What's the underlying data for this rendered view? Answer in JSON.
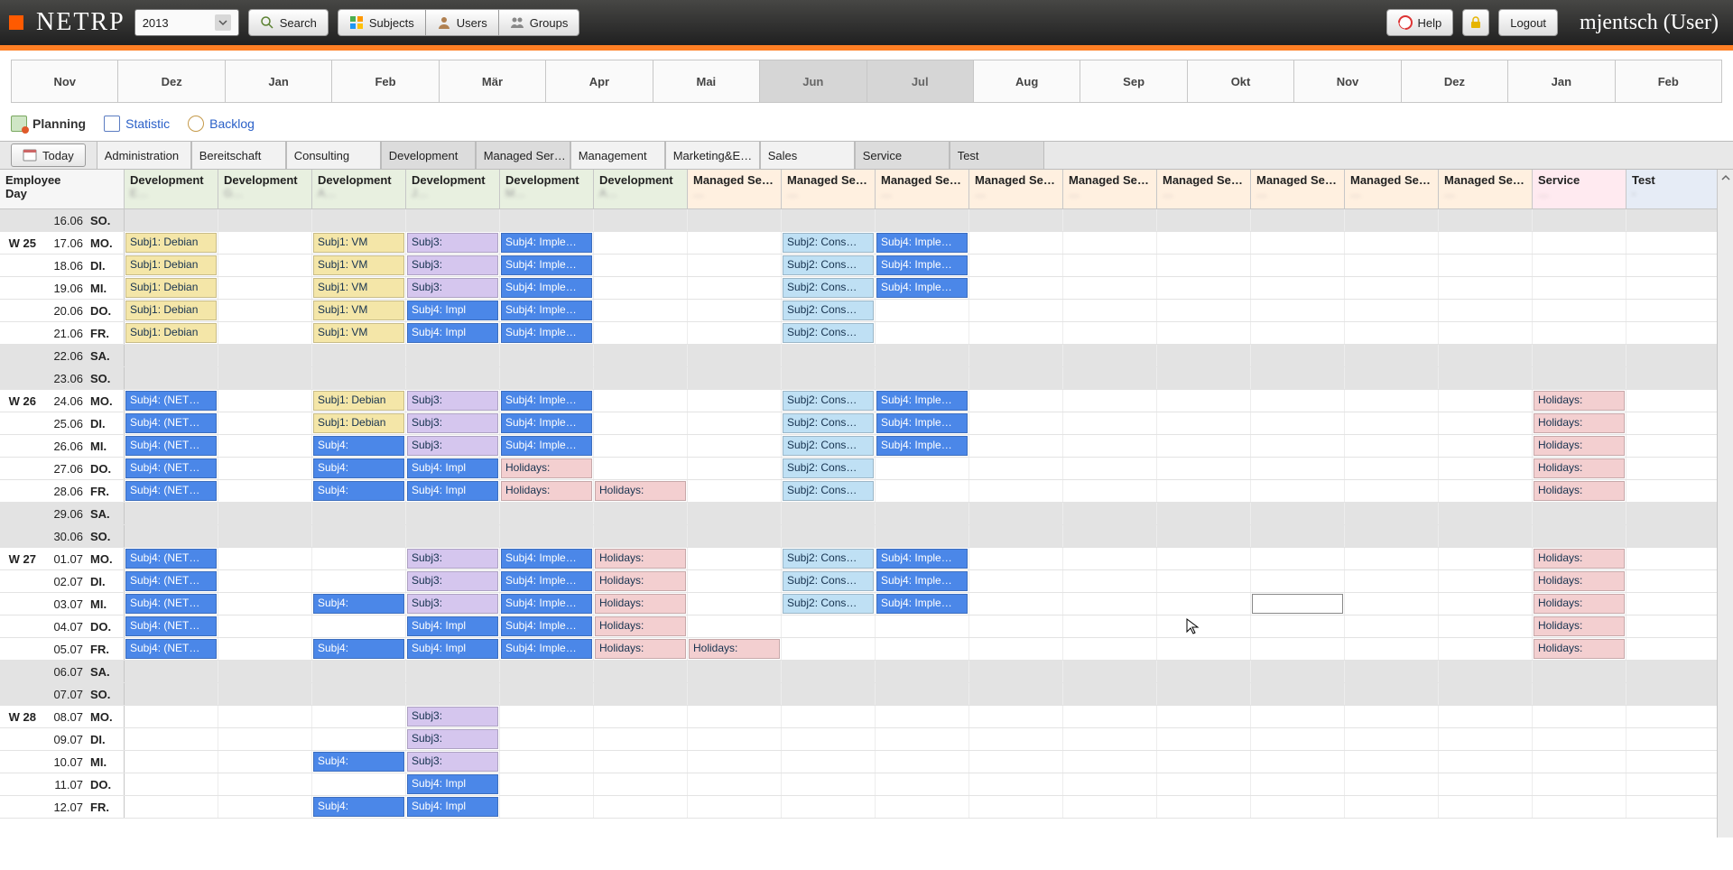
{
  "app": {
    "name": "NETRP",
    "year": "2013"
  },
  "toolbar": {
    "search": "Search",
    "subjects": "Subjects",
    "users": "Users",
    "groups": "Groups",
    "help": "Help",
    "logout": "Logout",
    "user": "mjentsch (User)"
  },
  "months": [
    {
      "label": "Nov",
      "sel": false
    },
    {
      "label": "Dez",
      "sel": false
    },
    {
      "label": "Jan",
      "sel": false
    },
    {
      "label": "Feb",
      "sel": false
    },
    {
      "label": "Mär",
      "sel": false
    },
    {
      "label": "Apr",
      "sel": false
    },
    {
      "label": "Mai",
      "sel": false
    },
    {
      "label": "Jun",
      "sel": true
    },
    {
      "label": "Jul",
      "sel": true
    },
    {
      "label": "Aug",
      "sel": false
    },
    {
      "label": "Sep",
      "sel": false
    },
    {
      "label": "Okt",
      "sel": false
    },
    {
      "label": "Nov",
      "sel": false
    },
    {
      "label": "Dez",
      "sel": false
    },
    {
      "label": "Jan",
      "sel": false
    },
    {
      "label": "Feb",
      "sel": false
    }
  ],
  "viewtabs": [
    {
      "label": "Planning",
      "active": true,
      "icon": "plan"
    },
    {
      "label": "Statistic",
      "active": false,
      "icon": "stat"
    },
    {
      "label": "Backlog",
      "active": false,
      "icon": "back"
    }
  ],
  "today_label": "Today",
  "departments": [
    {
      "label": "Administration",
      "sel": false
    },
    {
      "label": "Bereitschaft",
      "sel": false
    },
    {
      "label": "Consulting",
      "sel": false
    },
    {
      "label": "Development",
      "sel": true
    },
    {
      "label": "Managed Ser…",
      "sel": true
    },
    {
      "label": "Management",
      "sel": false
    },
    {
      "label": "Marketing&E…",
      "sel": false
    },
    {
      "label": "Sales",
      "sel": false
    },
    {
      "label": "Service",
      "sel": true
    },
    {
      "label": "Test",
      "sel": true
    }
  ],
  "grid_header_left": {
    "line1": "Employee",
    "line2": "Day"
  },
  "columns": [
    {
      "title": "Development",
      "type": "Development",
      "sub": "E…"
    },
    {
      "title": "Development",
      "type": "Development",
      "sub": "G…"
    },
    {
      "title": "Development",
      "type": "Development",
      "sub": "A…"
    },
    {
      "title": "Development",
      "type": "Development",
      "sub": "J…"
    },
    {
      "title": "Development",
      "type": "Development",
      "sub": "M…"
    },
    {
      "title": "Development",
      "type": "Development",
      "sub": "A…"
    },
    {
      "title": "Managed Se…",
      "type": "Managed",
      "sub": "…"
    },
    {
      "title": "Managed Se…",
      "type": "Managed",
      "sub": "…"
    },
    {
      "title": "Managed Se…",
      "type": "Managed",
      "sub": "…"
    },
    {
      "title": "Managed Se…",
      "type": "Managed",
      "sub": "…"
    },
    {
      "title": "Managed Se…",
      "type": "Managed",
      "sub": "…"
    },
    {
      "title": "Managed Se…",
      "type": "Managed",
      "sub": "…"
    },
    {
      "title": "Managed Se…",
      "type": "Managed",
      "sub": "…"
    },
    {
      "title": "Managed Se…",
      "type": "Managed",
      "sub": "…"
    },
    {
      "title": "Managed Se…",
      "type": "Managed",
      "sub": "…"
    },
    {
      "title": "Service",
      "type": "Service",
      "sub": "…"
    },
    {
      "title": "Test",
      "type": "Test",
      "sub": "-"
    }
  ],
  "rows": [
    {
      "week": "",
      "date": "16.06",
      "dow": "SO.",
      "weekend": true,
      "cells": []
    },
    {
      "week": "W 25",
      "date": "17.06",
      "dow": "MO.",
      "cells": [
        {
          "c": 0,
          "t": "Subj1: Debian",
          "k": "beige"
        },
        {
          "c": 2,
          "t": "Subj1: VM",
          "k": "beige"
        },
        {
          "c": 3,
          "t": "Subj3:",
          "k": "violet"
        },
        {
          "c": 4,
          "t": "Subj4: Imple…",
          "k": "blue"
        },
        {
          "c": 7,
          "t": "Subj2: Cons…",
          "k": "skyblue"
        },
        {
          "c": 8,
          "t": "Subj4: Imple…",
          "k": "blue"
        }
      ]
    },
    {
      "week": "",
      "date": "18.06",
      "dow": "DI.",
      "cells": [
        {
          "c": 0,
          "t": "Subj1: Debian",
          "k": "beige"
        },
        {
          "c": 2,
          "t": "Subj1: VM",
          "k": "beige"
        },
        {
          "c": 3,
          "t": "Subj3:",
          "k": "violet"
        },
        {
          "c": 4,
          "t": "Subj4: Imple…",
          "k": "blue"
        },
        {
          "c": 7,
          "t": "Subj2: Cons…",
          "k": "skyblue"
        },
        {
          "c": 8,
          "t": "Subj4: Imple…",
          "k": "blue"
        }
      ]
    },
    {
      "week": "",
      "date": "19.06",
      "dow": "MI.",
      "cells": [
        {
          "c": 0,
          "t": "Subj1: Debian",
          "k": "beige"
        },
        {
          "c": 2,
          "t": "Subj1: VM",
          "k": "beige"
        },
        {
          "c": 3,
          "t": "Subj3:",
          "k": "violet"
        },
        {
          "c": 4,
          "t": "Subj4: Imple…",
          "k": "blue"
        },
        {
          "c": 7,
          "t": "Subj2: Cons…",
          "k": "skyblue"
        },
        {
          "c": 8,
          "t": "Subj4: Imple…",
          "k": "blue"
        }
      ]
    },
    {
      "week": "",
      "date": "20.06",
      "dow": "DO.",
      "cells": [
        {
          "c": 0,
          "t": "Subj1: Debian",
          "k": "beige"
        },
        {
          "c": 2,
          "t": "Subj1: VM",
          "k": "beige"
        },
        {
          "c": 3,
          "t": "Subj4: Impl",
          "k": "blue"
        },
        {
          "c": 4,
          "t": "Subj4: Imple…",
          "k": "blue"
        },
        {
          "c": 7,
          "t": "Subj2: Cons…",
          "k": "skyblue"
        }
      ]
    },
    {
      "week": "",
      "date": "21.06",
      "dow": "FR.",
      "cells": [
        {
          "c": 0,
          "t": "Subj1: Debian",
          "k": "beige"
        },
        {
          "c": 2,
          "t": "Subj1: VM",
          "k": "beige"
        },
        {
          "c": 3,
          "t": "Subj4: Impl",
          "k": "blue"
        },
        {
          "c": 4,
          "t": "Subj4: Imple…",
          "k": "blue"
        },
        {
          "c": 7,
          "t": "Subj2: Cons…",
          "k": "skyblue"
        }
      ]
    },
    {
      "week": "",
      "date": "22.06",
      "dow": "SA.",
      "weekend": true,
      "cells": []
    },
    {
      "week": "",
      "date": "23.06",
      "dow": "SO.",
      "weekend": true,
      "cells": []
    },
    {
      "week": "W 26",
      "date": "24.06",
      "dow": "MO.",
      "cells": [
        {
          "c": 0,
          "t": "Subj4: (NET…",
          "k": "blue"
        },
        {
          "c": 2,
          "t": "Subj1: Debian",
          "k": "beige"
        },
        {
          "c": 3,
          "t": "Subj3:",
          "k": "violet"
        },
        {
          "c": 4,
          "t": "Subj4: Imple…",
          "k": "blue"
        },
        {
          "c": 7,
          "t": "Subj2: Cons…",
          "k": "skyblue"
        },
        {
          "c": 8,
          "t": "Subj4: Imple…",
          "k": "blue"
        },
        {
          "c": 15,
          "t": "Holidays:",
          "k": "pink"
        }
      ]
    },
    {
      "week": "",
      "date": "25.06",
      "dow": "DI.",
      "cells": [
        {
          "c": 0,
          "t": "Subj4: (NET…",
          "k": "blue"
        },
        {
          "c": 2,
          "t": "Subj1: Debian",
          "k": "beige"
        },
        {
          "c": 3,
          "t": "Subj3:",
          "k": "violet"
        },
        {
          "c": 4,
          "t": "Subj4: Imple…",
          "k": "blue"
        },
        {
          "c": 7,
          "t": "Subj2: Cons…",
          "k": "skyblue"
        },
        {
          "c": 8,
          "t": "Subj4: Imple…",
          "k": "blue"
        },
        {
          "c": 15,
          "t": "Holidays:",
          "k": "pink"
        }
      ]
    },
    {
      "week": "",
      "date": "26.06",
      "dow": "MI.",
      "cells": [
        {
          "c": 0,
          "t": "Subj4: (NET…",
          "k": "blue"
        },
        {
          "c": 2,
          "t": "Subj4:",
          "k": "blue"
        },
        {
          "c": 3,
          "t": "Subj3:",
          "k": "violet"
        },
        {
          "c": 4,
          "t": "Subj4: Imple…",
          "k": "blue"
        },
        {
          "c": 7,
          "t": "Subj2: Cons…",
          "k": "skyblue"
        },
        {
          "c": 8,
          "t": "Subj4: Imple…",
          "k": "blue"
        },
        {
          "c": 15,
          "t": "Holidays:",
          "k": "pink"
        }
      ]
    },
    {
      "week": "",
      "date": "27.06",
      "dow": "DO.",
      "cells": [
        {
          "c": 0,
          "t": "Subj4: (NET…",
          "k": "blue"
        },
        {
          "c": 2,
          "t": "Subj4:",
          "k": "blue"
        },
        {
          "c": 3,
          "t": "Subj4: Impl",
          "k": "blue"
        },
        {
          "c": 4,
          "t": "Holidays:",
          "k": "pink"
        },
        {
          "c": 7,
          "t": "Subj2: Cons…",
          "k": "skyblue"
        },
        {
          "c": 15,
          "t": "Holidays:",
          "k": "pink"
        }
      ]
    },
    {
      "week": "",
      "date": "28.06",
      "dow": "FR.",
      "cells": [
        {
          "c": 0,
          "t": "Subj4: (NET…",
          "k": "blue"
        },
        {
          "c": 2,
          "t": "Subj4:",
          "k": "blue"
        },
        {
          "c": 3,
          "t": "Subj4: Impl",
          "k": "blue"
        },
        {
          "c": 4,
          "t": "Holidays:",
          "k": "pink"
        },
        {
          "c": 5,
          "t": "Holidays:",
          "k": "pink"
        },
        {
          "c": 7,
          "t": "Subj2: Cons…",
          "k": "skyblue"
        },
        {
          "c": 15,
          "t": "Holidays:",
          "k": "pink"
        }
      ]
    },
    {
      "week": "",
      "date": "29.06",
      "dow": "SA.",
      "weekend": true,
      "cells": []
    },
    {
      "week": "",
      "date": "30.06",
      "dow": "SO.",
      "weekend": true,
      "cells": []
    },
    {
      "week": "W 27",
      "date": "01.07",
      "dow": "MO.",
      "cells": [
        {
          "c": 0,
          "t": "Subj4: (NET…",
          "k": "blue"
        },
        {
          "c": 3,
          "t": "Subj3:",
          "k": "violet"
        },
        {
          "c": 4,
          "t": "Subj4: Imple…",
          "k": "blue"
        },
        {
          "c": 5,
          "t": "Holidays:",
          "k": "pink"
        },
        {
          "c": 7,
          "t": "Subj2: Cons…",
          "k": "skyblue"
        },
        {
          "c": 8,
          "t": "Subj4: Imple…",
          "k": "blue"
        },
        {
          "c": 15,
          "t": "Holidays:",
          "k": "pink"
        }
      ]
    },
    {
      "week": "",
      "date": "02.07",
      "dow": "DI.",
      "cells": [
        {
          "c": 0,
          "t": "Subj4: (NET…",
          "k": "blue"
        },
        {
          "c": 3,
          "t": "Subj3:",
          "k": "violet"
        },
        {
          "c": 4,
          "t": "Subj4: Imple…",
          "k": "blue"
        },
        {
          "c": 5,
          "t": "Holidays:",
          "k": "pink"
        },
        {
          "c": 7,
          "t": "Subj2: Cons…",
          "k": "skyblue"
        },
        {
          "c": 8,
          "t": "Subj4: Imple…",
          "k": "blue"
        },
        {
          "c": 15,
          "t": "Holidays:",
          "k": "pink"
        }
      ]
    },
    {
      "week": "",
      "date": "03.07",
      "dow": "MI.",
      "cells": [
        {
          "c": 0,
          "t": "Subj4: (NET…",
          "k": "blue"
        },
        {
          "c": 2,
          "t": "Subj4:",
          "k": "blue"
        },
        {
          "c": 3,
          "t": "Subj3:",
          "k": "violet"
        },
        {
          "c": 4,
          "t": "Subj4: Imple…",
          "k": "blue"
        },
        {
          "c": 5,
          "t": "Holidays:",
          "k": "pink"
        },
        {
          "c": 7,
          "t": "Subj2: Cons…",
          "k": "skyblue"
        },
        {
          "c": 8,
          "t": "Subj4: Imple…",
          "k": "blue"
        },
        {
          "c": 15,
          "t": "Holidays:",
          "k": "pink"
        }
      ]
    },
    {
      "week": "",
      "date": "04.07",
      "dow": "DO.",
      "cells": [
        {
          "c": 0,
          "t": "Subj4: (NET…",
          "k": "blue"
        },
        {
          "c": 3,
          "t": "Subj4: Impl",
          "k": "blue"
        },
        {
          "c": 4,
          "t": "Subj4: Imple…",
          "k": "blue"
        },
        {
          "c": 5,
          "t": "Holidays:",
          "k": "pink"
        },
        {
          "c": 15,
          "t": "Holidays:",
          "k": "pink"
        }
      ]
    },
    {
      "week": "",
      "date": "05.07",
      "dow": "FR.",
      "cells": [
        {
          "c": 0,
          "t": "Subj4: (NET…",
          "k": "blue"
        },
        {
          "c": 2,
          "t": "Subj4:",
          "k": "blue"
        },
        {
          "c": 3,
          "t": "Subj4: Impl",
          "k": "blue"
        },
        {
          "c": 4,
          "t": "Subj4: Imple…",
          "k": "blue"
        },
        {
          "c": 5,
          "t": "Holidays:",
          "k": "pink"
        },
        {
          "c": 6,
          "t": "Holidays:",
          "k": "pink"
        },
        {
          "c": 15,
          "t": "Holidays:",
          "k": "pink"
        }
      ]
    },
    {
      "week": "",
      "date": "06.07",
      "dow": "SA.",
      "weekend": true,
      "cells": []
    },
    {
      "week": "",
      "date": "07.07",
      "dow": "SO.",
      "weekend": true,
      "cells": []
    },
    {
      "week": "W 28",
      "date": "08.07",
      "dow": "MO.",
      "cells": [
        {
          "c": 3,
          "t": "Subj3:",
          "k": "violet"
        }
      ]
    },
    {
      "week": "",
      "date": "09.07",
      "dow": "DI.",
      "cells": [
        {
          "c": 3,
          "t": "Subj3:",
          "k": "violet"
        }
      ]
    },
    {
      "week": "",
      "date": "10.07",
      "dow": "MI.",
      "cells": [
        {
          "c": 2,
          "t": "Subj4:",
          "k": "blue"
        },
        {
          "c": 3,
          "t": "Subj3:",
          "k": "violet"
        }
      ]
    },
    {
      "week": "",
      "date": "11.07",
      "dow": "DO.",
      "cells": [
        {
          "c": 3,
          "t": "Subj4: Impl",
          "k": "blue"
        }
      ]
    },
    {
      "week": "",
      "date": "12.07",
      "dow": "FR.",
      "cells": [
        {
          "c": 2,
          "t": "Subj4:",
          "k": "blue"
        },
        {
          "c": 3,
          "t": "Subj4: Impl",
          "k": "blue"
        }
      ]
    }
  ],
  "selection": {
    "rowIndex": 17,
    "colIndex": 12
  },
  "cursor_pos": {
    "rowIndex": 18,
    "colIndex": 11
  }
}
